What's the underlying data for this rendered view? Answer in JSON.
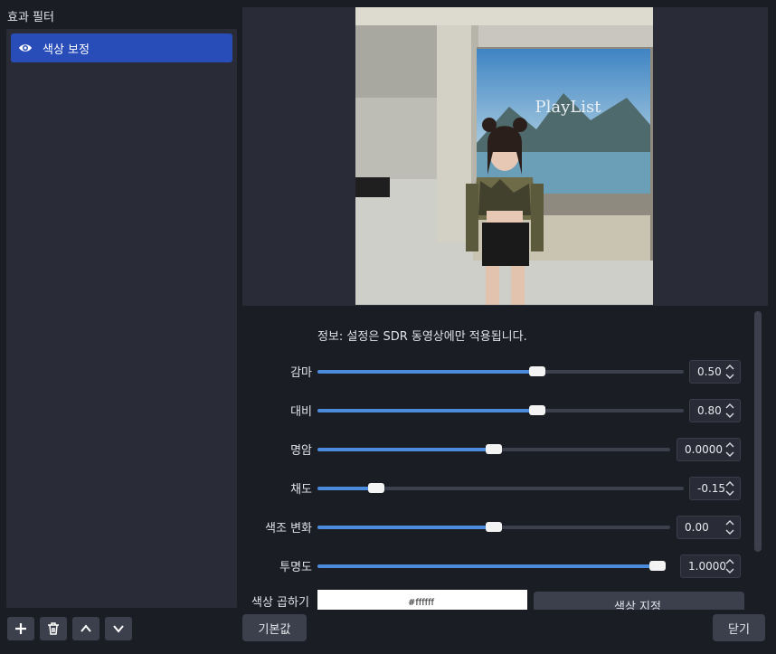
{
  "panel": {
    "title": "효과 필터"
  },
  "filters": [
    {
      "label": "색상 보정",
      "visible": true
    }
  ],
  "list_toolbar": {
    "icons": [
      "plus-icon",
      "trash-icon",
      "chevron-up-icon",
      "chevron-down-icon"
    ]
  },
  "preview": {
    "overlay_text": "PlayList"
  },
  "settings": {
    "note": "정보: 설정은 SDR 동영상에만 적용됩니다.",
    "sliders": [
      {
        "label": "감마",
        "value": "0.50",
        "fraction": 0.6
      },
      {
        "label": "대비",
        "value": "0.80",
        "fraction": 0.6
      },
      {
        "label": "명암",
        "value": "0.0000",
        "fraction": 0.5
      },
      {
        "label": "채도",
        "value": "-0.15",
        "fraction": 0.16
      },
      {
        "label": "색조 변화",
        "value": "0.00",
        "fraction": 0.5
      },
      {
        "label": "투명도",
        "value": "1.0000",
        "fraction": 1.0
      }
    ],
    "color_multiply": {
      "label": "색상 곱하기",
      "value": "#ffffff",
      "button_label": "색상 지정"
    }
  },
  "buttons": {
    "defaults": "기본값",
    "close": "닫기"
  },
  "colors": {
    "accent": "#284cb8",
    "slider_fill": "#4a8bdc",
    "background": "#1b1d25",
    "panel": "#292c37"
  }
}
